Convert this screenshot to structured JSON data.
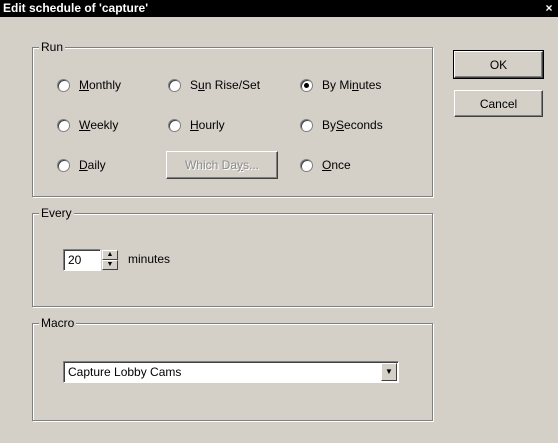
{
  "window": {
    "title": "Edit schedule of 'capture'",
    "close_glyph": "×"
  },
  "run": {
    "label": "Run",
    "options": [
      {
        "pre": "",
        "mn": "M",
        "post": "onthly",
        "selected": false
      },
      {
        "pre": "S",
        "mn": "u",
        "post": "n Rise/Set",
        "selected": false
      },
      {
        "pre": "By Mi",
        "mn": "n",
        "post": "utes",
        "selected": true
      },
      {
        "pre": "",
        "mn": "W",
        "post": "eekly",
        "selected": false
      },
      {
        "pre": "",
        "mn": "H",
        "post": "ourly",
        "selected": false
      },
      {
        "pre": "By ",
        "mn": "S",
        "post": "econds",
        "selected": false
      },
      {
        "pre": "",
        "mn": "D",
        "post": "aily",
        "selected": false
      },
      {
        "pre": "",
        "mn": "O",
        "post": "nce",
        "selected": false
      }
    ],
    "which_days": {
      "pre": "Which Da",
      "mn": "y",
      "post": "s..."
    }
  },
  "every": {
    "label": "Every",
    "value": "20",
    "unit": "minutes"
  },
  "macro": {
    "label": "Macro",
    "selected": "Capture Lobby Cams"
  },
  "buttons": {
    "ok": "OK",
    "cancel": "Cancel"
  }
}
